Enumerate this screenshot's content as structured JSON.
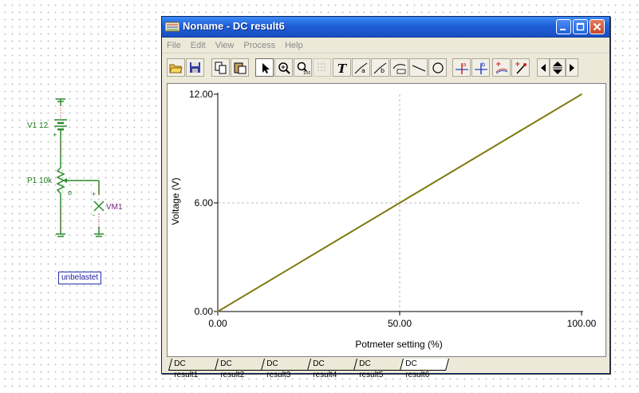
{
  "schematic": {
    "battery_label": "V1 12",
    "battery_plus": "+",
    "pot_label": "P1 10k",
    "pot_wiper_mark": "o",
    "meter_label": "VM1",
    "meter_plus": "+",
    "meter_minus": "-",
    "annotation_box": "unbelastet",
    "colors": {
      "wire": "#2a8a2a",
      "pin": "#cc2222",
      "meter": "#7a2a7a"
    }
  },
  "window": {
    "title": "Noname - DC result6",
    "app_icon": "tina-app-icon",
    "controls": [
      "minimize-icon",
      "maximize-icon",
      "close-icon"
    ]
  },
  "menu": [
    "File",
    "Edit",
    "View",
    "Process",
    "Help"
  ],
  "toolbar": {
    "buttons": [
      "open-folder-icon",
      "save-icon",
      "copy-icon",
      "paste-icon",
      "pointer-icon",
      "zoom-in-icon",
      "zoom-100-icon",
      "grid-icon",
      "text-icon",
      "cursor-a-icon",
      "cursor-b-icon",
      "curve-label-icon",
      "line-icon",
      "circle-icon",
      "marker-a-icon",
      "marker-b-icon",
      "add-curve-icon",
      "add-point-icon",
      "scroll-left-icon",
      "scroll-updown-icon",
      "scroll-right-icon"
    ]
  },
  "chart_data": {
    "type": "line",
    "xlabel": "Potmeter setting (%)",
    "ylabel": "Voltage (V)",
    "xlim": [
      0,
      100
    ],
    "ylim": [
      0,
      12
    ],
    "x_ticks": [
      "0.00",
      "50.00",
      "100.00"
    ],
    "y_ticks": [
      "0.00",
      "6.00",
      "12.00"
    ],
    "grid": true,
    "series": [
      {
        "x": [
          0,
          25,
          50,
          75,
          100
        ],
        "y": [
          0,
          3,
          6,
          9,
          12
        ],
        "color": "#7f7a10"
      }
    ]
  },
  "tabs": [
    "DC result1",
    "DC result2",
    "DC result3",
    "DC result4",
    "DC result5",
    "DC result6"
  ],
  "active_tab": "DC result6"
}
